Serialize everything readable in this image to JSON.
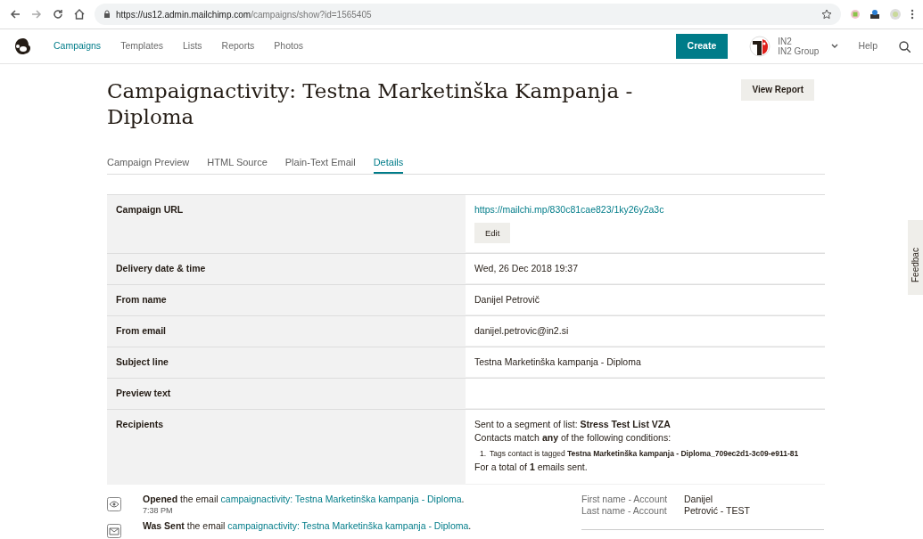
{
  "browser": {
    "url_host": "https://us12.admin.mailchimp.com",
    "url_path": "/campaigns/show?id=1565405"
  },
  "nav": {
    "items": [
      {
        "label": "Campaigns",
        "selected": true
      },
      {
        "label": "Templates",
        "selected": false
      },
      {
        "label": "Lists",
        "selected": false
      },
      {
        "label": "Reports",
        "selected": false
      },
      {
        "label": "Photos",
        "selected": false
      }
    ],
    "create": "Create",
    "account": {
      "line1": "IN2",
      "line2": "IN2 Group"
    },
    "help": "Help"
  },
  "title": "Campaignactivity: Testna Marketinška Kampanja - Diploma",
  "view_report": "View Report",
  "tabs": [
    {
      "label": "Campaign Preview",
      "selected": false
    },
    {
      "label": "HTML Source",
      "selected": false
    },
    {
      "label": "Plain-Text Email",
      "selected": false
    },
    {
      "label": "Details",
      "selected": true
    }
  ],
  "details": [
    {
      "label": "Campaign URL",
      "kind": "link",
      "value": "https://mailchi.mp/830c81cae823/1ky26y2a3c",
      "button": "Edit"
    },
    {
      "label": "Delivery date & time",
      "kind": "text",
      "value": "Wed, 26 Dec 2018 19:37"
    },
    {
      "label": "From name",
      "kind": "text",
      "value": "Danijel Petrovič"
    },
    {
      "label": "From email",
      "kind": "text",
      "value": "danijel.petrovic@in2.si"
    },
    {
      "label": "Subject line",
      "kind": "text",
      "value": "Testna Marketinška kampanja - Diploma"
    },
    {
      "label": "Preview text",
      "kind": "empty"
    },
    {
      "label": "Recipients",
      "kind": "recipients",
      "segment": "Sent to a segment of list: **Stress Test List VZA**",
      "match": "Contacts match **any** of the following conditions:",
      "conditions": [
        {
          "number": "1.",
          "text": "Tags contact is tagged **Testna Marketinška kampanja - Diploma_709ec2d1-3c09-e911-81**"
        }
      ],
      "total": "For a total of **1** emails sent."
    }
  ],
  "activity": [
    {
      "kind": "opened",
      "action": "Opened",
      "text": "the email",
      "link": "campaignactivity: Testna Marketinška kampanja - Diploma",
      "end": ".",
      "time": "7:38 PM"
    },
    {
      "kind": "sent",
      "action": "Was Sent",
      "text": "the email",
      "link": "campaignactivity: Testna Marketinška kampanja - Diploma",
      "end": "."
    }
  ],
  "fields": [
    {
      "label": "First name - Account",
      "value": "Danijel"
    },
    {
      "label": "Last name - Account",
      "value": "Petrović - TEST"
    }
  ],
  "feedback": "Feedbac"
}
